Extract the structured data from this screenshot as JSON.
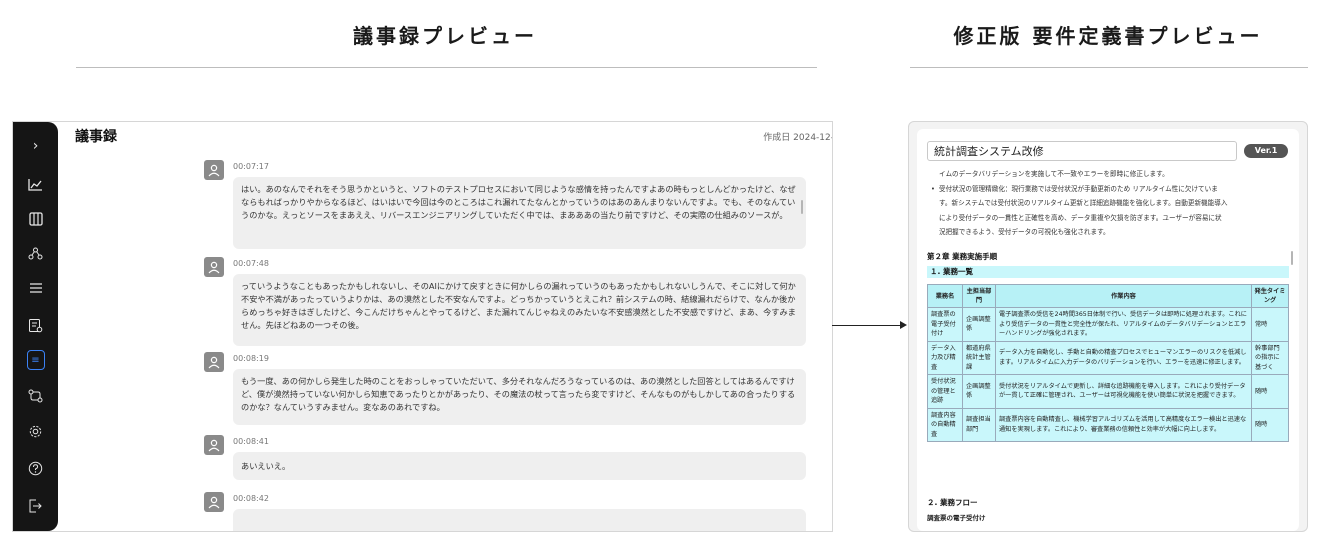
{
  "headings": {
    "left": "議事録プレビュー",
    "right": "修正版 要件定義書プレビュー"
  },
  "minutes": {
    "title": "議事録",
    "date": "作成日 2024-12-",
    "sidebar_icons": [
      "chevron-right-icon",
      "chart-icon",
      "columns-icon",
      "mind-map-icon",
      "list-icon",
      "settings-doc-icon",
      "document-icon",
      "flow-icon",
      "gear-icon",
      "help-icon",
      "logout-icon"
    ],
    "messages": [
      {
        "time": "00:07:17",
        "text": "はい。あのなんでそれをそう思うかというと、ソフトのテストプロセスにおいて同じような感情を持ったんですよあの時もっとしんどかったけど、なぜならもればっかりやからなるほど、はいはいで今回は今のところはこれ漏れてたなんとかっていうのはあのあんまりないんですよ。でも、そのなんていうのかな。えっとソースをまあええ、リバースエンジニアリングしていただく中では、まあああの当たり前ですけど、その実際の仕組みのソースが。"
      },
      {
        "time": "00:07:48",
        "text": "っていうようなこともあったかもしれないし、そのAIにかけて戻すときに何かしらの漏れっていうのもあったかもしれないしうんで、そこに対して何か不安や不満があったっていうよりかは、あの漠然とした不安なんですよ。どっちかっていうとえこれ？前システムの時、結線漏れだらけで、なんか後からめっちゃ好きはぎしたけど、今こんだけちゃんとやってるけど、また漏れてんじゃねえのみたいな不安感漠然とした不安感ですけど、まあ、今すみません。先ほどねあの一つその後。"
      },
      {
        "time": "00:08:19",
        "text": "もう一度、あの何かしら発生した時のことをおっしゃっていただいて、多分それなんだろうなっているのは、あの漠然とした回答としてはあるんですけど、僕が漠然持っていない何かしら知恵であったりとかがあったり、その魔法の杖って言ったら変ですけど、そんなものがもしかしてあの合ったりするのかな？なんていうすみません。変なあのあれですね。"
      },
      {
        "time": "00:08:41",
        "text": "あいえいえ。"
      },
      {
        "time": "00:08:42",
        "text": ""
      }
    ]
  },
  "preview": {
    "doc_title": "統計調査システム改修",
    "version": "Ver.1",
    "intro_lines": [
      "イムのデータバリデーションを実施して不一致やエラーを即時に修正します。",
      "受付状況の管理精緻化：現行業務では受付状況が手動更新のため リアルタイム性に欠けていま",
      "す。新システムでは受付状況のリアルタイム更新と詳細追跡機能を強化します。自動更新機能導入",
      "により受付データの一貫性と正確性を高め、データ重複や欠損を防ぎます。ユーザーが容易に状",
      "況把握できるよう、受付データの可視化も強化されます。"
    ],
    "chapter": "第２章 業務実施手順",
    "section1": "１. 業務一覧",
    "table_headers": [
      "業務名",
      "主担当部門",
      "作業内容",
      "発生タイミング"
    ],
    "table_rows": [
      [
        "調査票の電子受付付け",
        "企画調整係",
        "電子調査票の受信を24時間365日体制で行い、受信データは即時に処理されます。これにより受信データの一貫性と完全性が保たれ、リアルタイムのデータバリデーションとエラーハンドリングが強化されます。",
        "常時"
      ],
      [
        "データ入力及び精査",
        "都道府県統計主管課",
        "データ入力を自動化し、手動と自動の精査プロセスでヒューマンエラーのリスクを低減します。リアルタイムに入力データのバリデーションを行い、エラーを迅速に修正します。",
        "幹事部門の指示に基づく"
      ],
      [
        "受付状況の管理と追跡",
        "企画調整係",
        "受付状況をリアルタイムで更新し、詳細な追跡機能を導入します。これにより受付データが一貫して正確に管理され、ユーザーは可視化機能を使い簡単に状況を把握できます。",
        "随時"
      ],
      [
        "調査内容の自動精査",
        "調査担当部門",
        "調査票内容を自動精査し、機械学習アルゴリズムを活用して高精度なエラー検出と迅速な通知を実現します。これにより、審査業務の信頼性と効率が大幅に向上します。",
        "随時"
      ]
    ],
    "section2": "２. 業務フロー",
    "flow_sub": "調査票の電子受付け"
  }
}
